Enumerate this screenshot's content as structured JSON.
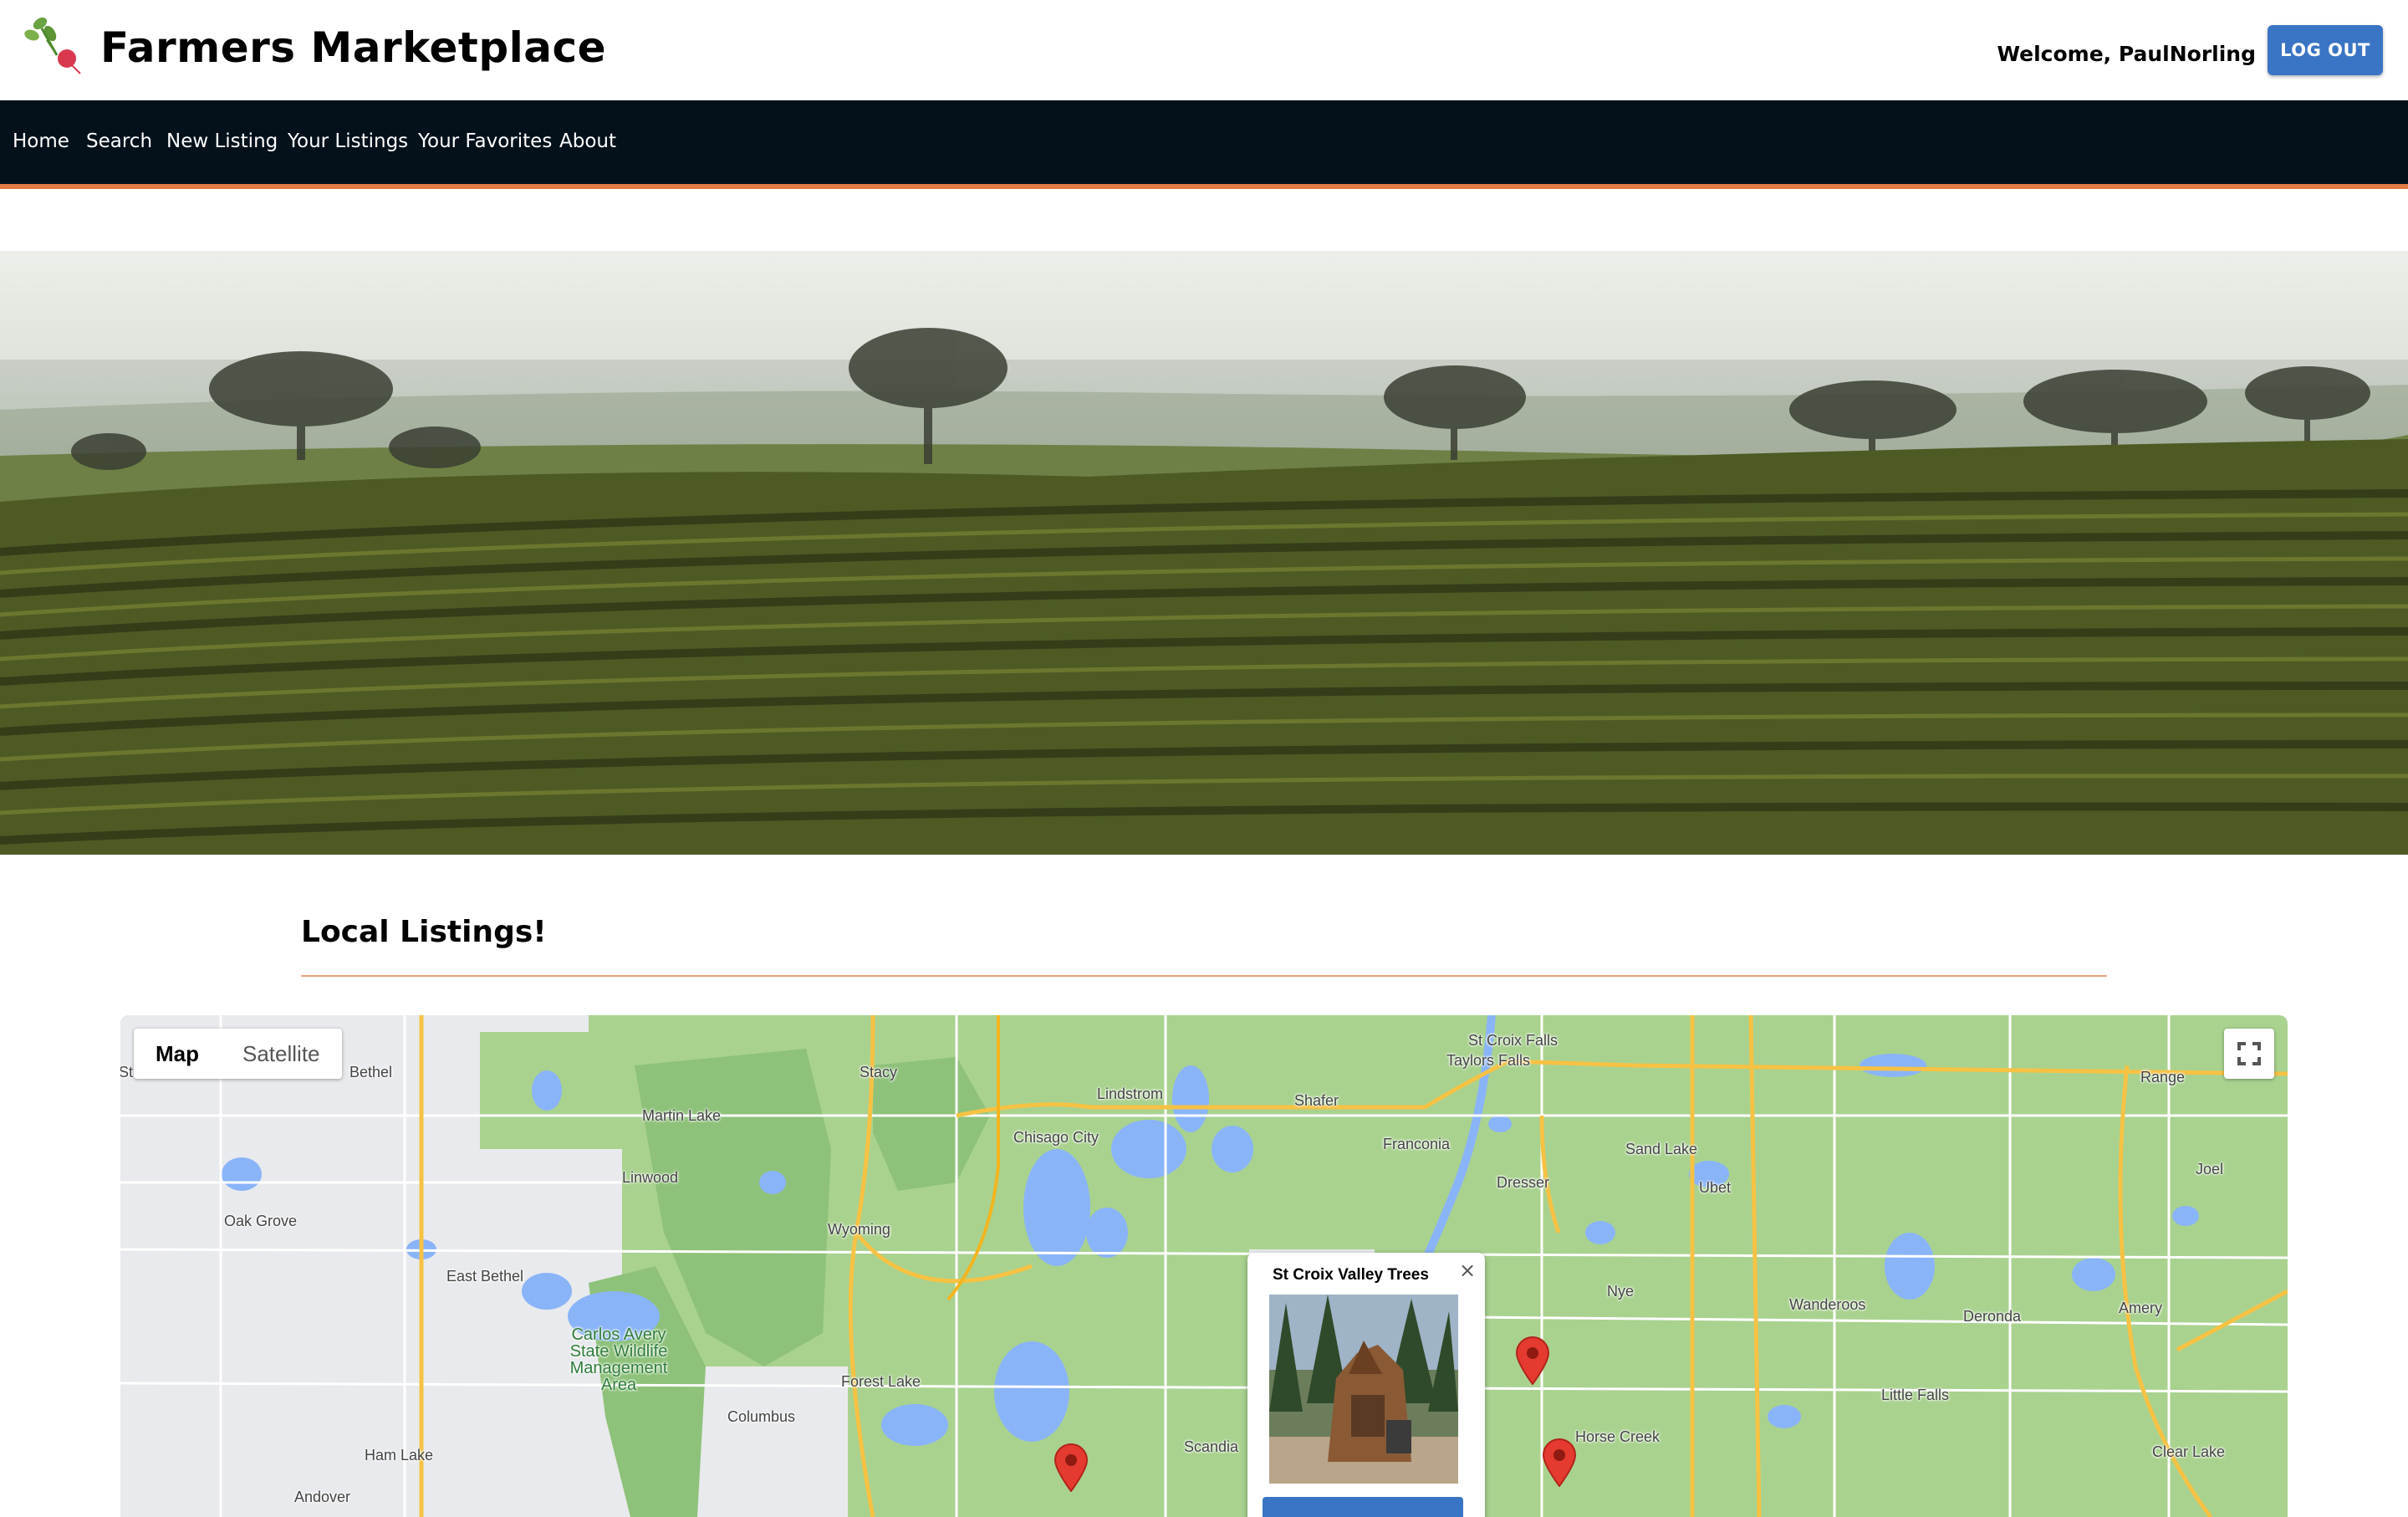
{
  "header": {
    "title": "Farmers Marketplace",
    "welcome": "Welcome, PaulNorling",
    "logout_label": "LOG OUT"
  },
  "nav": {
    "items": [
      {
        "label": "Home"
      },
      {
        "label": "Search"
      },
      {
        "label": "New Listing"
      },
      {
        "label": "Your Listings"
      },
      {
        "label": "Your Favorites"
      },
      {
        "label": "About"
      }
    ]
  },
  "section": {
    "title": "Local Listings!"
  },
  "map": {
    "map_type": {
      "map": "Map",
      "satellite": "Satellite",
      "selected": "Map"
    },
    "places": {
      "bethel": "Bethel",
      "st": "St",
      "stacy": "Stacy",
      "lindstrom": "Lindstrom",
      "shafer": "Shafer",
      "st_croix_falls": "St Croix Falls",
      "taylors_falls": "Taylors Falls",
      "range": "Range",
      "martin_lake": "Martin Lake",
      "chisago_city": "Chisago City",
      "franconia": "Franconia",
      "sand_lake": "Sand Lake",
      "linwood": "Linwood",
      "dresser": "Dresser",
      "ubet": "Ubet",
      "joel": "Joel",
      "oak_grove": "Oak Grove",
      "wyoming": "Wyoming",
      "east_bethel": "East Bethel",
      "nye": "Nye",
      "wanderoos": "Wanderoos",
      "deronda": "Deronda",
      "amery": "Amery",
      "carlos_avery": "Carlos Avery State Wildlife Management Area",
      "forest_lake": "Forest Lake",
      "little_falls": "Little Falls",
      "columbus": "Columbus",
      "horse_creek": "Horse Creek",
      "scandia": "Scandia",
      "ham_lake": "Ham Lake",
      "clear_lake": "Clear Lake",
      "andover": "Andover"
    },
    "info_window": {
      "title": "St Croix Valley Trees",
      "close": "×"
    },
    "colors": {
      "land": "#a9d28f",
      "urban": "#e8eaed",
      "water": "#8ab4f8",
      "highway": "#f6c244",
      "marker": "#e53a2f"
    }
  }
}
